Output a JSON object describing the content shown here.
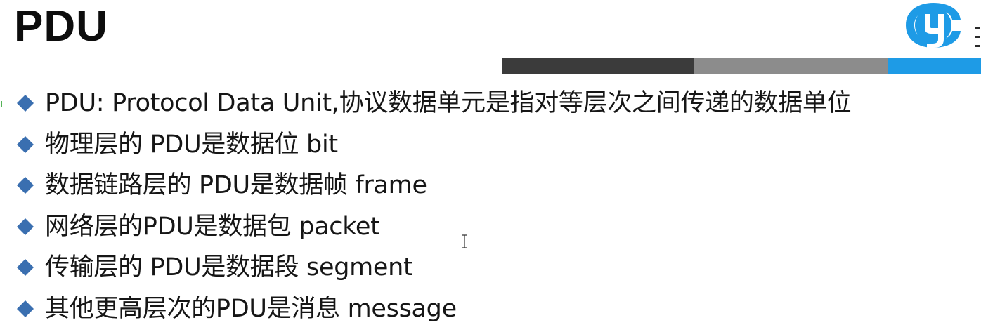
{
  "slide": {
    "title": "PDU",
    "bullets": [
      "PDU: Protocol Data Unit,协议数据单元是指对等层次之间传递的数据单位",
      "物理层的 PDU是数据位 bit",
      "数据链路层的 PDU是数据帧 frame",
      "网络层的PDU是数据包 packet",
      "传输层的 PDU是数据段 segment",
      "其他更高层次的PDU是消息 message"
    ]
  },
  "colors": {
    "bullet": "#3a6fb0",
    "accent_dark": "#3b3b3b",
    "accent_gray": "#8c8c8c",
    "accent_blue": "#1e9be6",
    "logo_blue": "#1e9be6"
  },
  "icons": {
    "logo": "brand-logo-icon",
    "bullet": "diamond-bullet-icon",
    "cursor": "text-cursor-icon"
  }
}
